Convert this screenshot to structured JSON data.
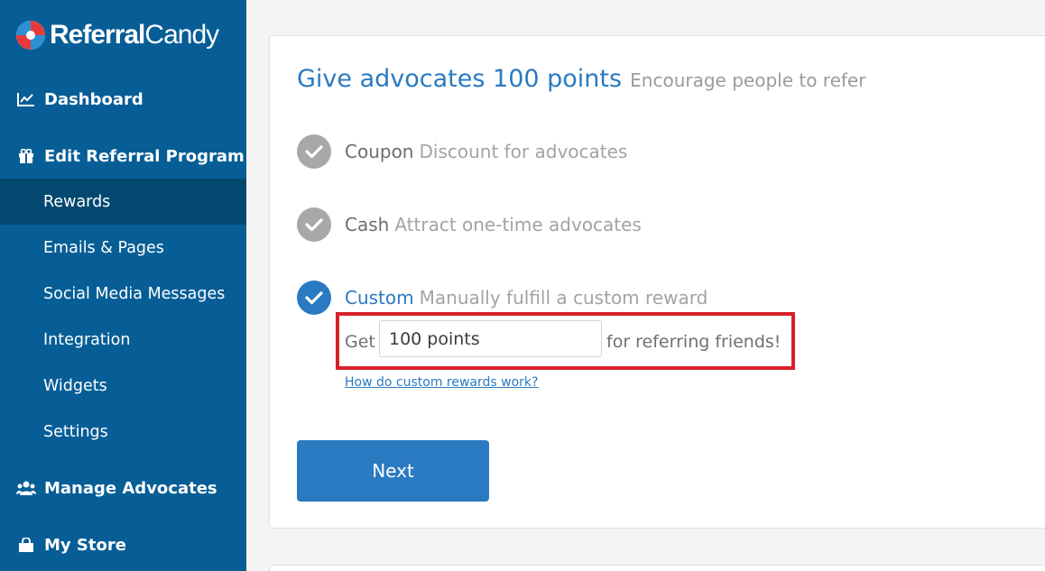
{
  "brand": {
    "name_bold": "Referral",
    "name_light": "Candy"
  },
  "sidebar": {
    "dashboard": {
      "label": "Dashboard",
      "icon": "chart-line-icon"
    },
    "edit_program": {
      "label": "Edit Referral Program",
      "icon": "gift-icon"
    },
    "sub_items": [
      {
        "label": "Rewards",
        "active": true
      },
      {
        "label": "Emails & Pages",
        "active": false
      },
      {
        "label": "Social Media Messages",
        "active": false
      },
      {
        "label": "Integration",
        "active": false
      },
      {
        "label": "Widgets",
        "active": false
      },
      {
        "label": "Settings",
        "active": false
      }
    ],
    "manage_advocates": {
      "label": "Manage Advocates",
      "icon": "users-icon"
    },
    "my_store": {
      "label": "My Store",
      "icon": "shopping-bag-icon"
    }
  },
  "main": {
    "title": "Give advocates 100 points",
    "subtitle": "Encourage people to refer",
    "options": [
      {
        "label": "Coupon",
        "desc": "Discount for advocates",
        "selected": false
      },
      {
        "label": "Cash",
        "desc": "Attract one-time advocates",
        "selected": false
      },
      {
        "label": "Custom",
        "desc": "Manually fulfill a custom reward",
        "selected": true
      }
    ],
    "reward": {
      "prefix": "Get",
      "value": "100 points",
      "suffix": "for referring friends!"
    },
    "help_link": "How do custom rewards work?",
    "next_button": "Next"
  },
  "colors": {
    "sidebar_bg": "#075e96",
    "sidebar_active": "#03496f",
    "accent": "#2a7ac1",
    "highlight_border": "#d8202b"
  }
}
